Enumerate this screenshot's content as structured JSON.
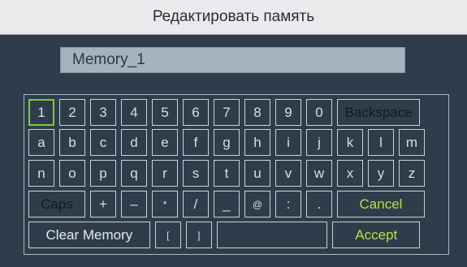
{
  "dialog": {
    "title": "Редактировать память",
    "name_value": "Memory_1"
  },
  "keyboard": {
    "selected_key": "1",
    "rows": [
      [
        {
          "label": "1",
          "name": "key-1"
        },
        {
          "label": "2",
          "name": "key-2"
        },
        {
          "label": "3",
          "name": "key-3"
        },
        {
          "label": "4",
          "name": "key-4"
        },
        {
          "label": "5",
          "name": "key-5"
        },
        {
          "label": "6",
          "name": "key-6"
        },
        {
          "label": "7",
          "name": "key-7"
        },
        {
          "label": "8",
          "name": "key-8"
        },
        {
          "label": "9",
          "name": "key-9"
        },
        {
          "label": "0",
          "name": "key-0"
        },
        {
          "label": "Backspace",
          "name": "backspace-key"
        }
      ],
      [
        {
          "label": "a",
          "name": "key-a"
        },
        {
          "label": "b",
          "name": "key-b"
        },
        {
          "label": "c",
          "name": "key-c"
        },
        {
          "label": "d",
          "name": "key-d"
        },
        {
          "label": "e",
          "name": "key-e"
        },
        {
          "label": "f",
          "name": "key-f"
        },
        {
          "label": "g",
          "name": "key-g"
        },
        {
          "label": "h",
          "name": "key-h"
        },
        {
          "label": "i",
          "name": "key-i"
        },
        {
          "label": "j",
          "name": "key-j"
        },
        {
          "label": "k",
          "name": "key-k"
        },
        {
          "label": "l",
          "name": "key-l"
        },
        {
          "label": "m",
          "name": "key-m"
        }
      ],
      [
        {
          "label": "n",
          "name": "key-n"
        },
        {
          "label": "o",
          "name": "key-o"
        },
        {
          "label": "p",
          "name": "key-p"
        },
        {
          "label": "q",
          "name": "key-q"
        },
        {
          "label": "r",
          "name": "key-r"
        },
        {
          "label": "s",
          "name": "key-s"
        },
        {
          "label": "t",
          "name": "key-t"
        },
        {
          "label": "u",
          "name": "key-u"
        },
        {
          "label": "v",
          "name": "key-v"
        },
        {
          "label": "w",
          "name": "key-w"
        },
        {
          "label": "x",
          "name": "key-x"
        },
        {
          "label": "y",
          "name": "key-y"
        },
        {
          "label": "z",
          "name": "key-z"
        }
      ],
      [
        {
          "label": "Caps",
          "name": "caps-key"
        },
        {
          "label": "+",
          "name": "key-plus"
        },
        {
          "label": "–",
          "name": "key-minus"
        },
        {
          "label": "*",
          "name": "key-asterisk"
        },
        {
          "label": "/",
          "name": "key-slash"
        },
        {
          "label": "_",
          "name": "key-underscore"
        },
        {
          "label": "@",
          "name": "key-at"
        },
        {
          "label": ":",
          "name": "key-colon"
        },
        {
          "label": ".",
          "name": "key-period"
        },
        {
          "label": "Cancel",
          "name": "cancel-button"
        }
      ],
      [
        {
          "label": "Clear Memory",
          "name": "clear-memory-button"
        },
        {
          "label": "[",
          "name": "key-left-bracket"
        },
        {
          "label": "]",
          "name": "key-right-bracket"
        },
        {
          "label": "",
          "name": "space-key"
        },
        {
          "label": "Accept",
          "name": "accept-button"
        }
      ]
    ]
  },
  "colors": {
    "panel_background": "#2f3d4b",
    "key_text": "#d8dde2",
    "action_text": "#b6e33c",
    "selection_outline": "#7fc83a"
  }
}
